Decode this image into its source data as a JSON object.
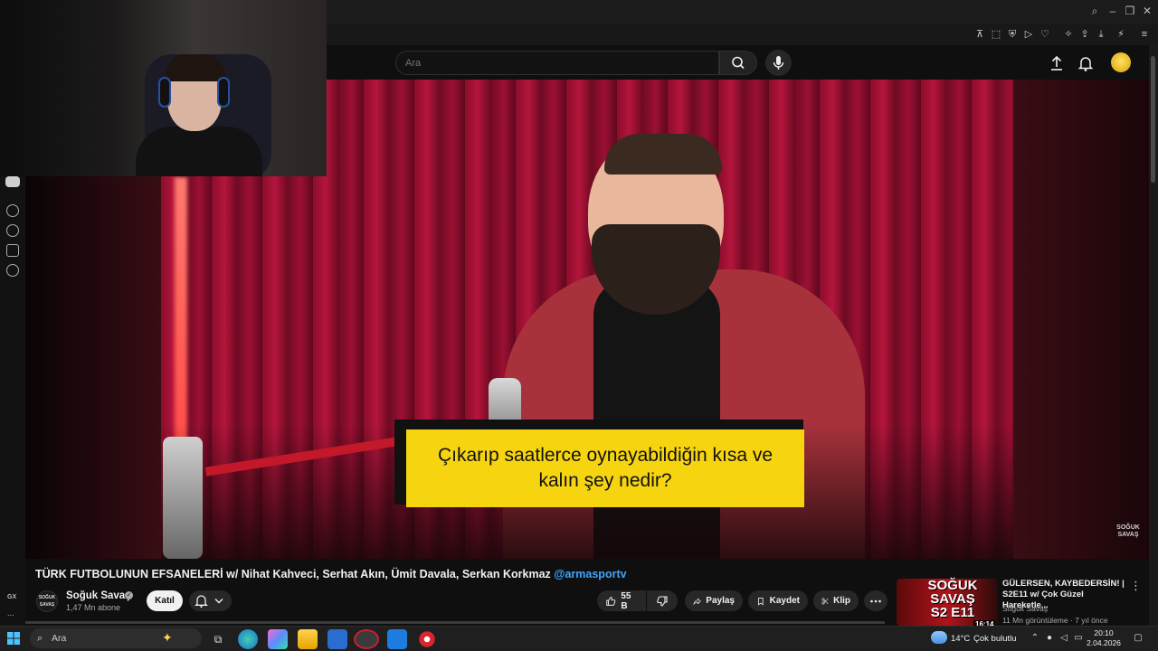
{
  "search": {
    "placeholder": "Ara"
  },
  "video": {
    "caption": "Çıkarıp saatlerce oynayabildiğin kısa ve kalın şey nedir?",
    "watermark": "SOĞUK SAVAŞ",
    "title": "TÜRK FUTBOLUNUN EFSANELERİ w/ Nihat Kahveci, Serhat Akın, Ümit Davala, Serkan Korkmaz",
    "title_mention": "@armasportv"
  },
  "channel": {
    "avatar_text": "SOĞUK SAVAŞ",
    "name": "Soğuk Savaş",
    "subscribers": "1,47 Mn abone",
    "join_label": "Katıl"
  },
  "actions": {
    "likes": "55 B",
    "share_label": "Paylaş",
    "save_label": "Kaydet",
    "clip_label": "Klip"
  },
  "recommended": {
    "thumb_text": "SOĞUK SAVAŞ S2 E11",
    "duration": "16:14",
    "title": "GÜLERSEN, KAYBEDERSİN! | S2E11 w/ Çok Güzel Hareketle...",
    "channel": "Soğuk Savaş",
    "meta": "11 Mn görüntüleme · 7 yıl önce"
  },
  "sidebar": {
    "gx_label": "GX",
    "more_label": "..."
  },
  "taskbar": {
    "search_placeholder": "Ara",
    "temperature": "14°C",
    "weather": "Çok bulutlu",
    "time": "20:10",
    "date": "2.04.2026"
  },
  "colors": {
    "accent_red": "#ff0000",
    "caption_yellow": "#f6d410",
    "link_blue": "#3ea6ff",
    "curtain_red": "#b5153c"
  }
}
